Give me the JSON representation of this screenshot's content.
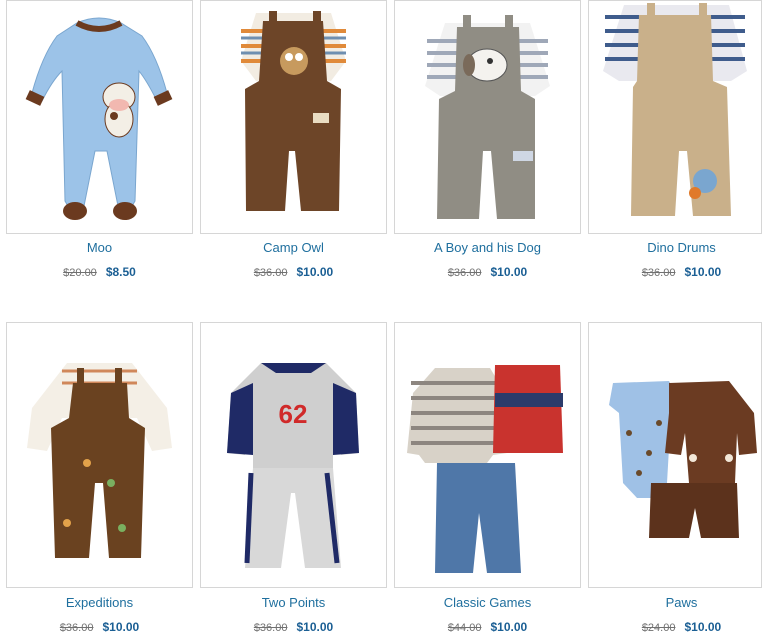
{
  "colors": {
    "link": "#1f6f9e",
    "price": "#1b5f94",
    "old_price": "#707070",
    "border": "#d6d6d6"
  },
  "products": [
    {
      "name": "Moo",
      "old_price": "$20.00",
      "price": "$8.50",
      "image": "blue-cow-footed-romper"
    },
    {
      "name": "Camp Owl",
      "old_price": "$36.00",
      "price": "$10.00",
      "image": "brown-corduroy-overalls-owl"
    },
    {
      "name": "A Boy and his Dog",
      "old_price": "$36.00",
      "price": "$10.00",
      "image": "grey-overalls-dog"
    },
    {
      "name": "Dino Drums",
      "old_price": "$36.00",
      "price": "$10.00",
      "image": "khaki-overalls-dino"
    },
    {
      "name": "Expeditions",
      "old_price": "$36.00",
      "price": "$10.00",
      "image": "brown-overalls-plaid-shirt"
    },
    {
      "name": "Two Points",
      "old_price": "$36.00",
      "price": "$10.00",
      "image": "navy-grey-track-suit",
      "image_text": "62"
    },
    {
      "name": "Classic Games",
      "old_price": "$44.00",
      "price": "$10.00",
      "image": "striped-hoodie-vest-jeans"
    },
    {
      "name": "Paws",
      "old_price": "$24.00",
      "price": "$10.00",
      "image": "bodysuit-brown-hoodie-set"
    }
  ]
}
